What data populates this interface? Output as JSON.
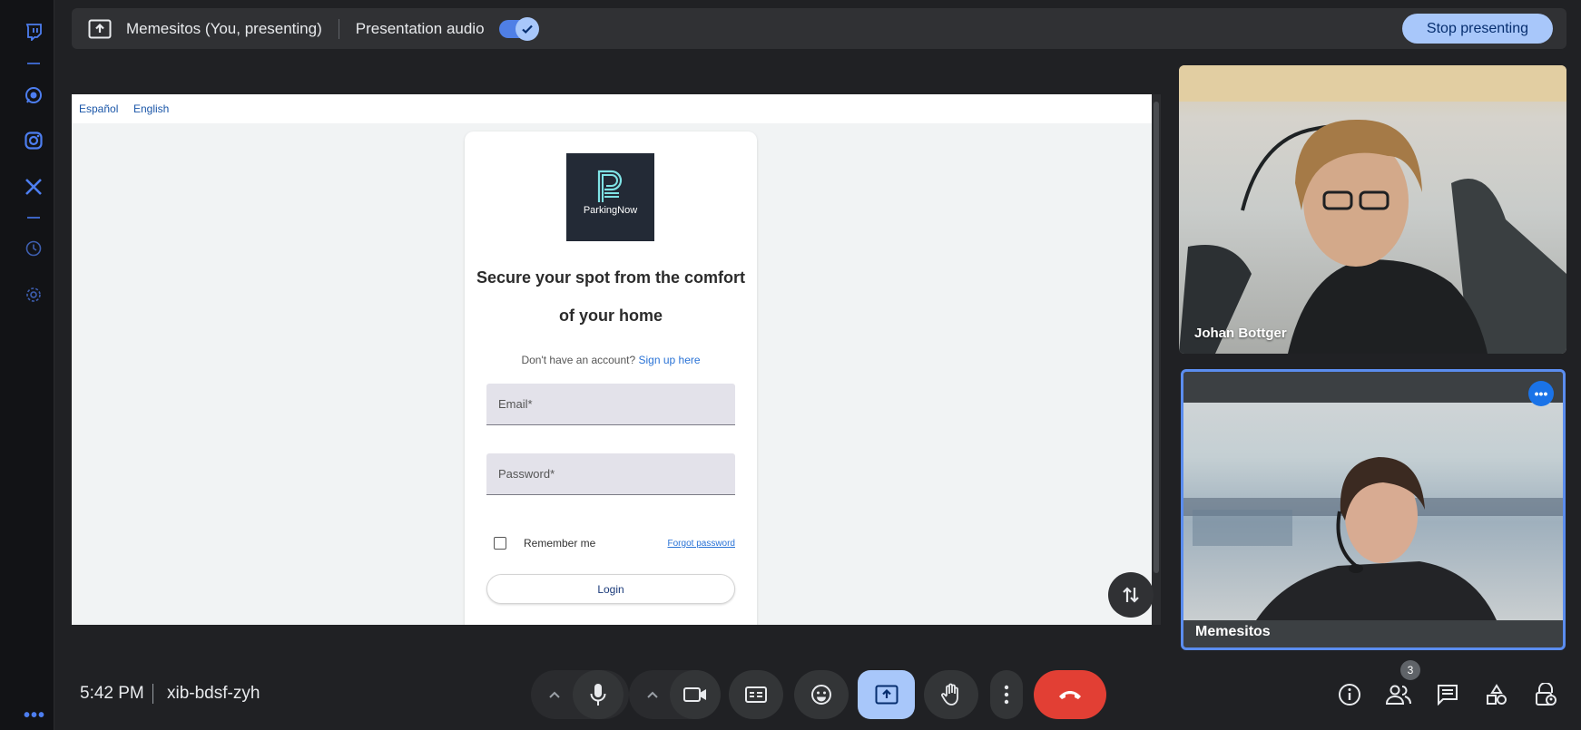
{
  "sidebar": {
    "icons": [
      "twitch-icon",
      "whatsapp-icon",
      "instagram-icon",
      "x-icon",
      "history-icon",
      "settings-icon"
    ],
    "more_label": "•••"
  },
  "present_bar": {
    "presenter_label": "Memesitos (You, presenting)",
    "audio_label": "Presentation audio",
    "audio_enabled": true,
    "stop_label": "Stop presenting"
  },
  "shared_screen": {
    "languages": [
      "Español",
      "English"
    ],
    "brand": "ParkingNow",
    "headline": "Secure your spot from the comfort of your home",
    "signup_prompt": "Don't have an account?",
    "signup_link": "Sign up here",
    "email_placeholder": "Email*",
    "password_placeholder": "Password*",
    "remember_label": "Remember me",
    "forgot_label": "Forgot password",
    "login_label": "Login"
  },
  "participants": [
    {
      "name": "Johan Bottger"
    },
    {
      "name": "Memesitos"
    }
  ],
  "bottom_bar": {
    "time": "5:42 PM",
    "meeting_code": "xib-bdsf-zyh",
    "participant_count": "3"
  },
  "colors": {
    "accent": "#a8c7fa",
    "end_call": "#e23f34",
    "toggle_on": "#4f7fe6"
  }
}
